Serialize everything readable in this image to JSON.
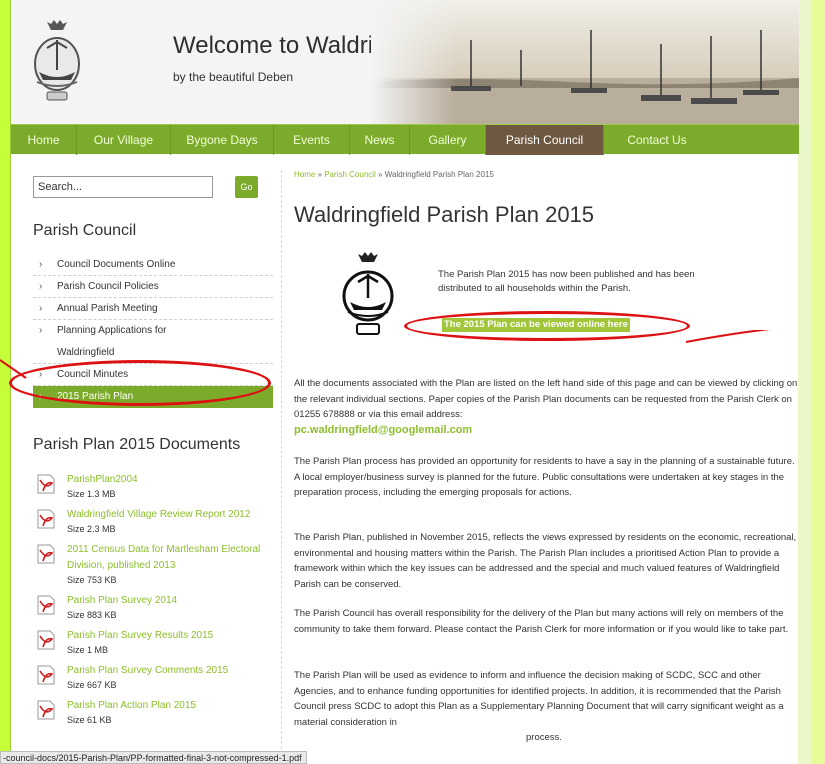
{
  "header": {
    "title": "Welcome to Waldringfield",
    "subtitle": "by the beautiful Deben",
    "logo_icon": "waldringfield-crest-icon"
  },
  "nav": {
    "items": [
      "Home",
      "Our Village",
      "Bygone Days",
      "Events",
      "News",
      "Gallery",
      "Parish Council",
      "Contact Us"
    ],
    "active": "Parish Council"
  },
  "search": {
    "placeholder": "Search...",
    "go_label": "Go"
  },
  "sidebar": {
    "parish_council_heading": "Parish Council",
    "parish_council_items": [
      "Council Documents Online",
      "Parish Council Policies",
      "Annual Parish Meeting",
      "Planning Applications for",
      "Waldringfield",
      "Council Minutes",
      "2015 Parish Plan"
    ],
    "active_item": "2015 Parish Plan",
    "documents_heading": "Parish Plan 2015 Documents",
    "documents": [
      {
        "title": "ParishPlan2004",
        "size": "Size 1.3 MB"
      },
      {
        "title": "Waldringfield Village Review Report 2012",
        "size": "Size 2.3 MB"
      },
      {
        "title": "2011 Census Data for Martlesham Electoral Division, published 2013",
        "size": "Size 753 KB"
      },
      {
        "title": "Parish Plan Survey 2014",
        "size": "Size 883 KB"
      },
      {
        "title": "Parish Plan Survey Results 2015",
        "size": "Size 1 MB"
      },
      {
        "title": "Parish Plan Survey Comments 2015",
        "size": "Size 667 KB"
      },
      {
        "title": "Parish Plan Action Plan 2015",
        "size": "Size 61 KB"
      }
    ]
  },
  "main": {
    "breadcrumb": {
      "home": "Home",
      "sep": " » ",
      "section": "Parish Council",
      "current": "Waldringfield Parish Plan 2015"
    },
    "title": "Waldringfield Parish Plan 2015",
    "intro": "The Parish Plan 2015 has now been published and has been distributed to all households within the Parish.",
    "view_online_link": "The 2015 Plan can be viewed online here",
    "para1": "All the documents associated with the Plan are listed on the left hand side of this page and can be viewed by clicking on the relevant individual sections.  Paper copies of the Parish Plan documents can be requested from the Parish Clerk on 01255 678888 or via this email address:",
    "email": "pc.waldringfield@googlemail.com",
    "para2": "The Parish Plan process has provided an opportunity for residents to have a say in the planning of a sustainable future.  A local employer/business survey is planned for the future.  Public consultations were undertaken at key stages in the preparation process, including the emerging proposals for actions.",
    "para3": "The Parish Plan, published in November 2015, reflects the views expressed by residents on the economic, recreational, environmental and housing matters within the Parish.  The Parish Plan includes a prioritised Action Plan to provide a framework within which the key issues can be addressed and the special and much valued features of Waldringfield Parish can be conserved.",
    "para4": "The Parish Council has overall responsibility for the delivery of the Plan but many actions will rely on members of the community to take them forward.  Please contact the Parish Clerk for more information or if you would like to take part.",
    "para5": "The Parish Plan will be used as evidence to inform and influence the decision making of SCDC, SCC and other Agencies, and to enhance funding opportunities for identified projects.  In addition, it is recommended that the Parish Council press SCDC to adopt this Plan as a Supplementary Planning Document that will carry significant weight as a material consideration in",
    "para5_tail": "process."
  },
  "status_bar": {
    "url": "-council-docs/2015-Parish-Plan/PP-formatted-final-3-not-compressed-1.pdf"
  },
  "colors": {
    "nav_green": "#7cab2c",
    "active_tab": "#6e5842",
    "link_green": "#8cbf2a",
    "annotation_red": "#dd1111"
  }
}
